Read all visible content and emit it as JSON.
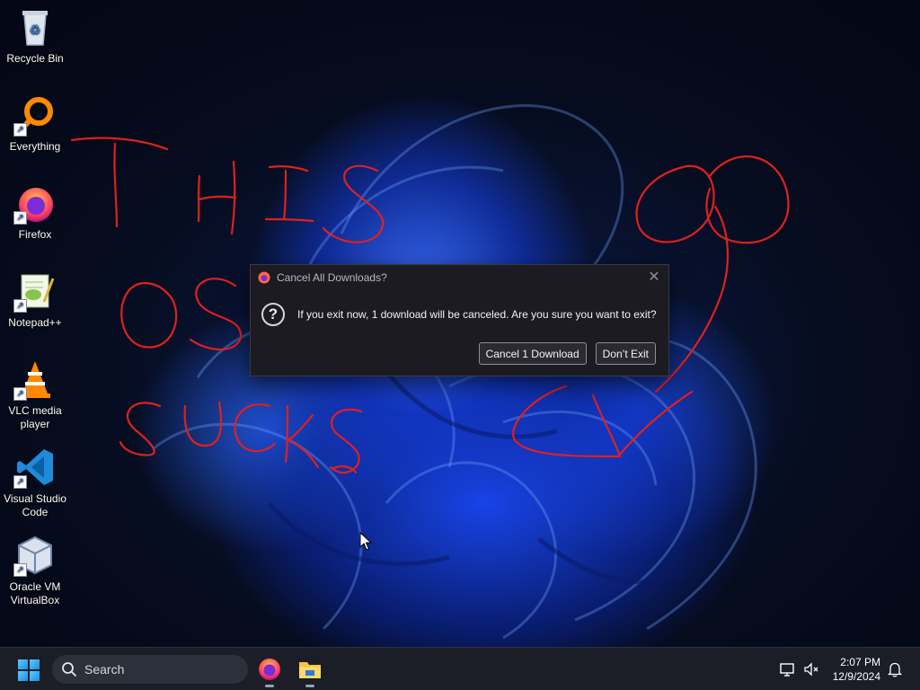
{
  "desktop": {
    "icons": [
      {
        "label": "Recycle Bin",
        "icon": "recycle-bin-icon"
      },
      {
        "label": "Everything",
        "icon": "everything-search-icon"
      },
      {
        "label": "Firefox",
        "icon": "firefox-icon"
      },
      {
        "label": "Notepad++",
        "icon": "notepad-plus-plus-icon"
      },
      {
        "label": "VLC media player",
        "icon": "vlc-icon"
      },
      {
        "label": "Visual Studio Code",
        "icon": "vscode-icon"
      },
      {
        "label": "Oracle VM VirtualBox",
        "icon": "virtualbox-icon"
      }
    ],
    "annotation_text": "THIS OS SUCKS",
    "scribble_color": "#e0201e"
  },
  "dialog": {
    "title": "Cancel All Downloads?",
    "message": "If you exit now, 1 download will be canceled. Are you sure you want to exit?",
    "confirm_label": "Cancel 1 Download",
    "cancel_label": "Don’t Exit",
    "close_glyph": "✕"
  },
  "taskbar": {
    "search_label": "Search",
    "apps": [
      "firefox-icon",
      "file-explorer-icon"
    ],
    "time": "2:07 PM",
    "date": "12/9/2024",
    "tray_icons": [
      "network-icon",
      "volume-muted-icon",
      "notifications-bell-icon"
    ]
  },
  "colors": {
    "dialog_bg": "#1c1b22",
    "taskbar_bg": "#1b1e27",
    "accent": "#1a8fe3",
    "wallpaper_blue": "#2a5bff"
  }
}
